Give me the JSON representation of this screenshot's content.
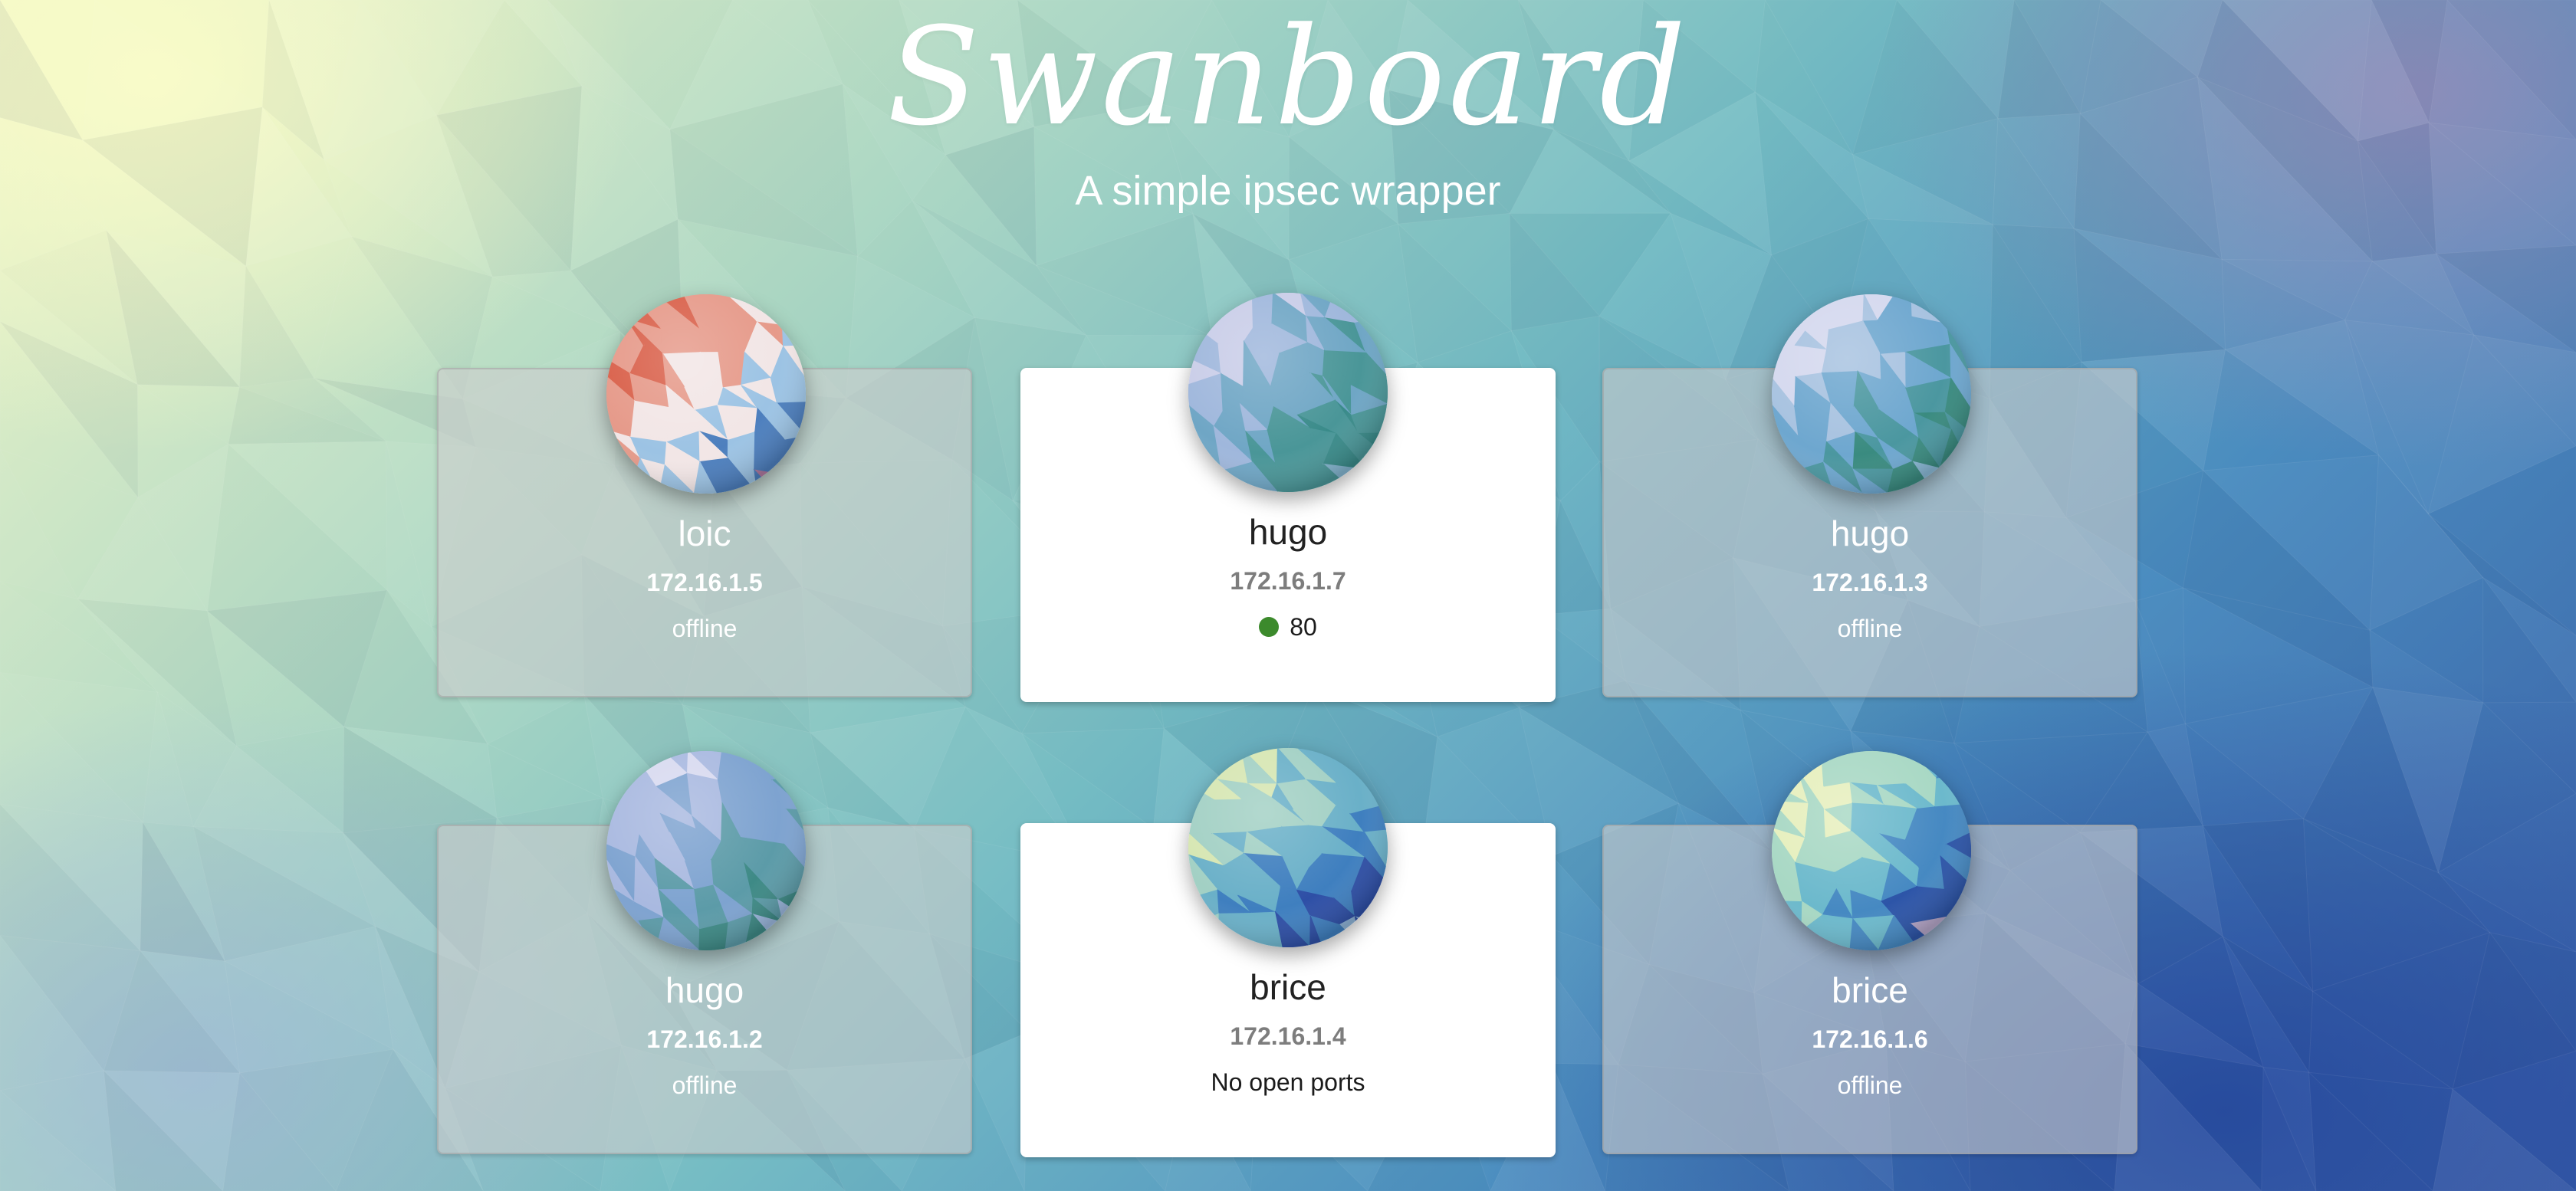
{
  "header": {
    "title": "Swanboard",
    "subtitle": "A simple ipsec wrapper"
  },
  "peers": [
    {
      "name": "loic",
      "ip": "172.16.1.5",
      "state": "offline",
      "status": "offline",
      "avatar_palette": [
        "#d9604a",
        "#e69a8a",
        "#f2e6e6",
        "#9cc3e4",
        "#4d7fbe",
        "#b07aa0"
      ]
    },
    {
      "name": "hugo",
      "ip": "172.16.1.7",
      "state": "online",
      "ports": [
        "80"
      ],
      "port_status_color": "#3c8a2c",
      "avatar_palette": [
        "#c9cde8",
        "#9fb7dc",
        "#6fa6c5",
        "#4a9698",
        "#3a8b8a",
        "#84b5cf"
      ]
    },
    {
      "name": "hugo",
      "ip": "172.16.1.3",
      "state": "offline",
      "status": "offline",
      "avatar_palette": [
        "#d4d8ee",
        "#a7c2e0",
        "#6ea7cf",
        "#4b97a0",
        "#3a8b80",
        "#8ab9d6"
      ]
    },
    {
      "name": "hugo",
      "ip": "172.16.1.2",
      "state": "offline",
      "status": "offline",
      "avatar_palette": [
        "#d8daf0",
        "#a9b9e0",
        "#7ea3d0",
        "#5c9ba8",
        "#3e8a86",
        "#9bb7dd"
      ]
    },
    {
      "name": "brice",
      "ip": "172.16.1.4",
      "state": "online",
      "status": "No open ports",
      "avatar_palette": [
        "#d6e6b2",
        "#a2d0c4",
        "#6ab0c8",
        "#3f7fbf",
        "#2e4fa6",
        "#8fb4d8"
      ]
    },
    {
      "name": "brice",
      "ip": "172.16.1.6",
      "state": "offline",
      "status": "offline",
      "avatar_palette": [
        "#e6efbd",
        "#a8d8c4",
        "#6cb9cc",
        "#4689c2",
        "#2d55a8",
        "#b5a6c8"
      ]
    }
  ],
  "colors": {
    "online_card": "#ffffff",
    "offline_card": "rgba(205,205,205,0.60)",
    "port_open": "#3c8a2c"
  }
}
